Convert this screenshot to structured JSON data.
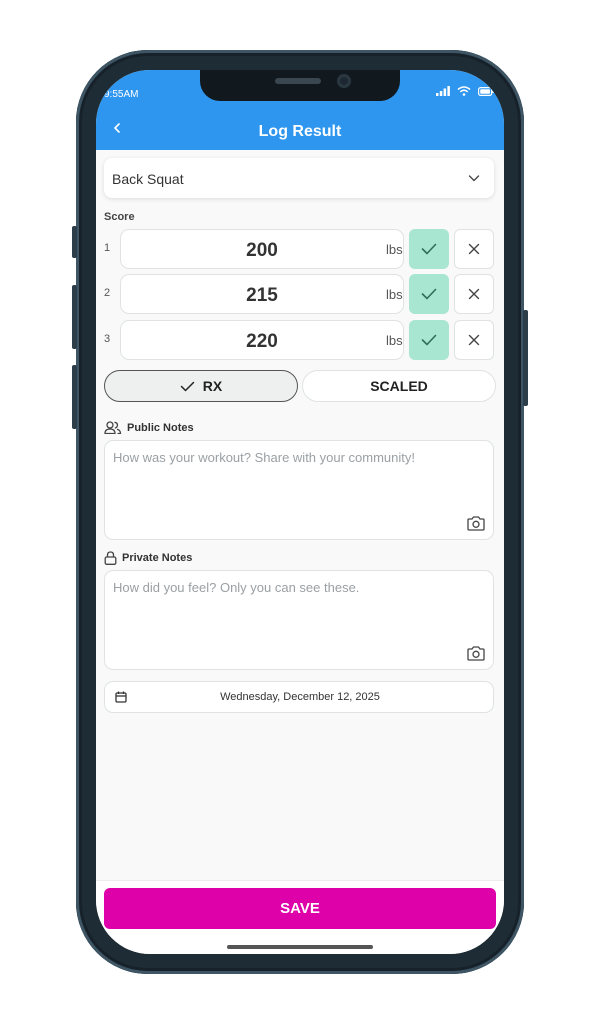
{
  "status_bar": {
    "time": "9:55AM"
  },
  "header": {
    "title": "Log Result"
  },
  "exercise": {
    "selected": "Back Squat"
  },
  "score": {
    "label": "Score",
    "rows": [
      {
        "index": "1",
        "value": "200",
        "unit": "lbs"
      },
      {
        "index": "2",
        "value": "215",
        "unit": "lbs"
      },
      {
        "index": "3",
        "value": "220",
        "unit": "lbs"
      }
    ]
  },
  "mode": {
    "rx_label": "RX",
    "scaled_label": "SCALED",
    "selected": "RX"
  },
  "public_notes": {
    "label": "Public Notes",
    "placeholder": "How was your workout? Share with your community!"
  },
  "private_notes": {
    "label": "Private Notes",
    "placeholder": "How did you feel? Only you can see these."
  },
  "date": {
    "value": "Wednesday, December 12, 2025"
  },
  "footer": {
    "save_label": "SAVE"
  },
  "colors": {
    "header": "#2e96ee",
    "save": "#de00a8",
    "confirm": "#a9e6d2"
  }
}
